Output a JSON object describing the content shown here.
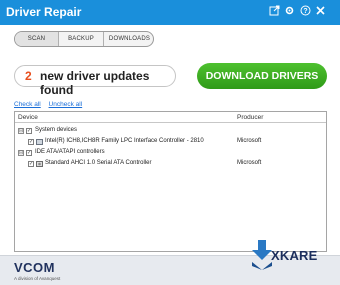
{
  "window": {
    "title": "Driver Repair"
  },
  "titlebar": {
    "icons": [
      "export-icon",
      "gear-icon",
      "help-icon",
      "close-icon"
    ]
  },
  "tabs": [
    {
      "label": "SCAN",
      "selected": true
    },
    {
      "label": "BACKUP",
      "selected": false
    },
    {
      "label": "DOWNLOADS",
      "selected": false
    }
  ],
  "summary": {
    "count": "2",
    "text": "new driver updates found"
  },
  "download_button": {
    "label": "DOWNLOAD DRIVERS",
    "color": "#38a823"
  },
  "links": {
    "check_all": "Check all",
    "uncheck_all": "Uncheck all"
  },
  "table": {
    "headers": {
      "device": "Device",
      "producer": "Producer"
    },
    "rows": [
      {
        "type": "category",
        "label": "System devices",
        "expander": "⊟",
        "checked": true
      },
      {
        "type": "device",
        "label": "Intel(R) ICH8,ICH8R Family LPC Interface Controller - 2810",
        "producer": "Microsoft",
        "checked": true
      },
      {
        "type": "category",
        "label": "IDE ATA/ATAPI controllers",
        "expander": "⊟",
        "checked": true
      },
      {
        "type": "device",
        "label": "Standard AHCI 1.0 Serial ATA Controller",
        "producer": "Microsoft",
        "checked": true
      }
    ]
  },
  "footer": {
    "brand": "VCOM",
    "brand_sub": "A division of Avanquest",
    "partner": "XKARE"
  },
  "colors": {
    "titlebar": "#1a8fdb",
    "accent_count": "#e84d1c",
    "link": "#1a6ed8",
    "footer_bg": "#e7eaef"
  }
}
